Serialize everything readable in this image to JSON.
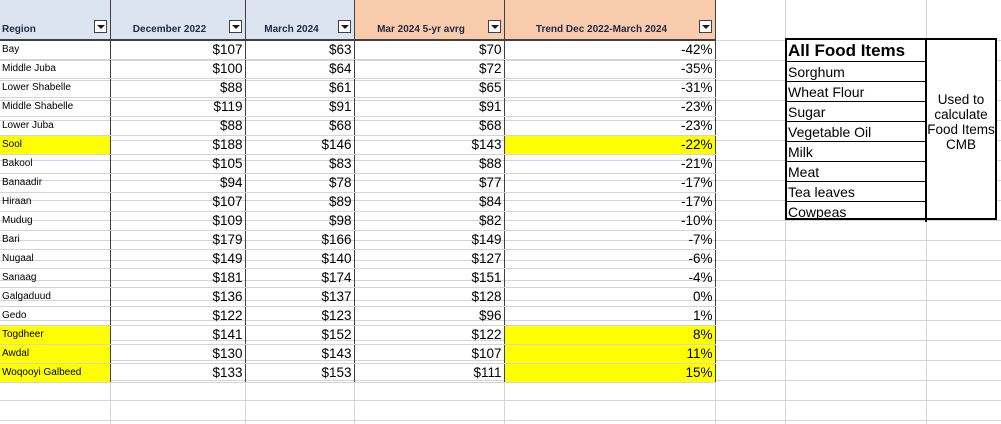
{
  "table": {
    "headers": [
      "Region",
      "December 2022",
      "March 2024",
      "Mar 2024 5-yr avrg",
      "Trend Dec 2022-March 2024"
    ],
    "rows": [
      {
        "region": "Bay",
        "dec2022": "$107",
        "mar2024": "$63",
        "avg5yr": "$70",
        "trend": "-42%",
        "region_highlight": false,
        "trend_highlight": false
      },
      {
        "region": "Middle Juba",
        "dec2022": "$100",
        "mar2024": "$64",
        "avg5yr": "$72",
        "trend": "-35%",
        "region_highlight": false,
        "trend_highlight": false
      },
      {
        "region": "Lower Shabelle",
        "dec2022": "$88",
        "mar2024": "$61",
        "avg5yr": "$65",
        "trend": "-31%",
        "region_highlight": false,
        "trend_highlight": false
      },
      {
        "region": "Middle Shabelle",
        "dec2022": "$119",
        "mar2024": "$91",
        "avg5yr": "$91",
        "trend": "-23%",
        "region_highlight": false,
        "trend_highlight": false
      },
      {
        "region": "Lower Juba",
        "dec2022": "$88",
        "mar2024": "$68",
        "avg5yr": "$68",
        "trend": "-23%",
        "region_highlight": false,
        "trend_highlight": false
      },
      {
        "region": "Sool",
        "dec2022": "$188",
        "mar2024": "$146",
        "avg5yr": "$143",
        "trend": "-22%",
        "region_highlight": true,
        "trend_highlight": true
      },
      {
        "region": "Bakool",
        "dec2022": "$105",
        "mar2024": "$83",
        "avg5yr": "$88",
        "trend": "-21%",
        "region_highlight": false,
        "trend_highlight": false
      },
      {
        "region": "Banaadir",
        "dec2022": "$94",
        "mar2024": "$78",
        "avg5yr": "$77",
        "trend": "-17%",
        "region_highlight": false,
        "trend_highlight": false
      },
      {
        "region": "Hiraan",
        "dec2022": "$107",
        "mar2024": "$89",
        "avg5yr": "$84",
        "trend": "-17%",
        "region_highlight": false,
        "trend_highlight": false
      },
      {
        "region": "Mudug",
        "dec2022": "$109",
        "mar2024": "$98",
        "avg5yr": "$82",
        "trend": "-10%",
        "region_highlight": false,
        "trend_highlight": false
      },
      {
        "region": "Bari",
        "dec2022": "$179",
        "mar2024": "$166",
        "avg5yr": "$149",
        "trend": "-7%",
        "region_highlight": false,
        "trend_highlight": false
      },
      {
        "region": "Nugaal",
        "dec2022": "$149",
        "mar2024": "$140",
        "avg5yr": "$127",
        "trend": "-6%",
        "region_highlight": false,
        "trend_highlight": false
      },
      {
        "region": "Sanaag",
        "dec2022": "$181",
        "mar2024": "$174",
        "avg5yr": "$151",
        "trend": "-4%",
        "region_highlight": false,
        "trend_highlight": false
      },
      {
        "region": "Galgaduud",
        "dec2022": "$136",
        "mar2024": "$137",
        "avg5yr": "$128",
        "trend": "0%",
        "region_highlight": false,
        "trend_highlight": false
      },
      {
        "region": "Gedo",
        "dec2022": "$122",
        "mar2024": "$123",
        "avg5yr": "$96",
        "trend": "1%",
        "region_highlight": false,
        "trend_highlight": false
      },
      {
        "region": "Togdheer",
        "dec2022": "$141",
        "mar2024": "$152",
        "avg5yr": "$122",
        "trend": "8%",
        "region_highlight": true,
        "trend_highlight": true
      },
      {
        "region": "Awdal",
        "dec2022": "$130",
        "mar2024": "$143",
        "avg5yr": "$107",
        "trend": "11%",
        "region_highlight": true,
        "trend_highlight": true
      },
      {
        "region": "Woqooyi Galbeed",
        "dec2022": "$133",
        "mar2024": "$153",
        "avg5yr": "$111",
        "trend": "15%",
        "region_highlight": true,
        "trend_highlight": true
      }
    ]
  },
  "food_box": {
    "title": "All Food Items",
    "items": [
      "Sorghum",
      "Wheat  Flour",
      "Sugar",
      "Vegetable Oil",
      "Milk",
      "Meat",
      "Tea leaves",
      "Cowpeas"
    ],
    "note": "Used to calculate Food Items CMB"
  },
  "colors": {
    "highlight": "#ffff00",
    "header_blue": "#dbe4f0",
    "header_orange": "#f8cbad"
  },
  "icons": {
    "filter": "filter-dropdown-icon"
  }
}
